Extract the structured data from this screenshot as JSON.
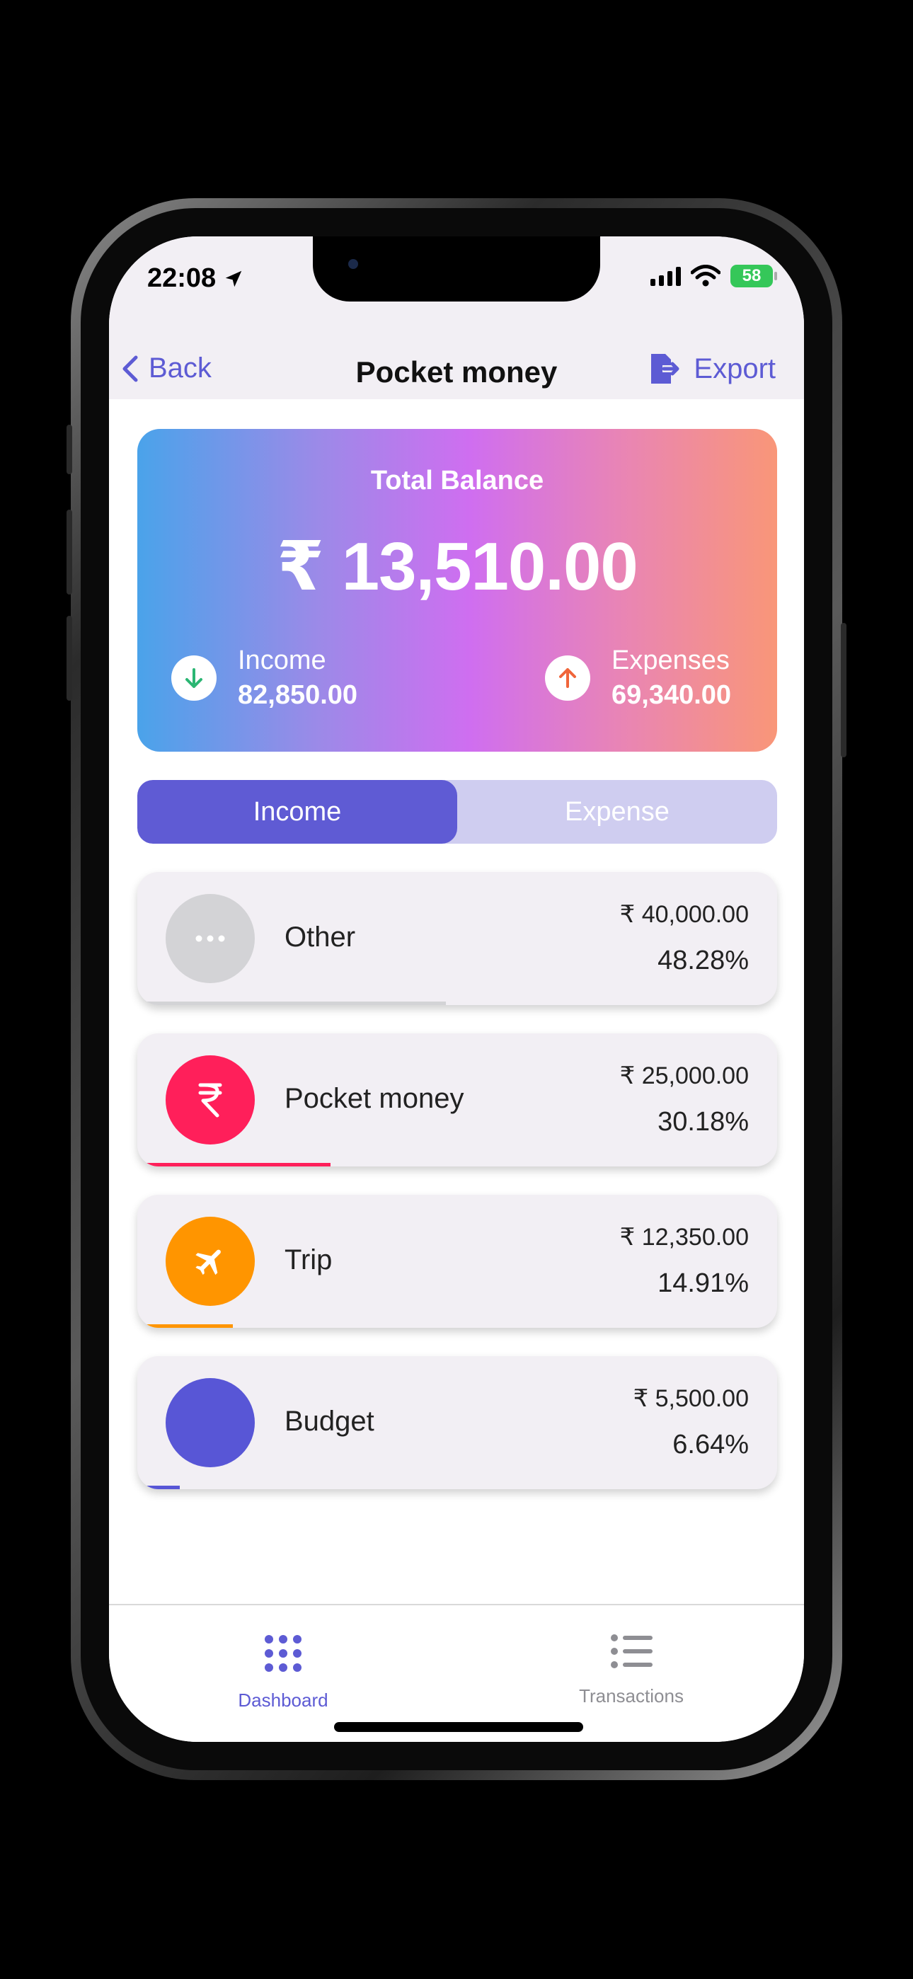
{
  "status": {
    "time": "22:08",
    "battery": "58"
  },
  "nav": {
    "back_label": "Back",
    "title": "Pocket money",
    "export_label": "Export"
  },
  "balance": {
    "label": "Total Balance",
    "amount": "₹ 13,510.00",
    "income_label": "Income",
    "income_value": "82,850.00",
    "expense_label": "Expenses",
    "expense_value": "69,340.00"
  },
  "tabs": {
    "income": "Income",
    "expense": "Expense",
    "active": "Income"
  },
  "categories": [
    {
      "name": "Other",
      "amount": "₹ 40,000.00",
      "percent": "48.28%",
      "share": 0.4828,
      "color": "#d3d3d6",
      "icon": "more-dots-icon"
    },
    {
      "name": "Pocket money",
      "amount": "₹ 25,000.00",
      "percent": "30.18%",
      "share": 0.3018,
      "color": "#ff1f5a",
      "icon": "rupee-icon"
    },
    {
      "name": "Trip",
      "amount": "₹ 12,350.00",
      "percent": "14.91%",
      "share": 0.1491,
      "color": "#ff9500",
      "icon": "airplane-icon"
    },
    {
      "name": "Budget",
      "amount": "₹ 5,500.00",
      "percent": "6.64%",
      "share": 0.0664,
      "color": "#5856d6",
      "icon": "circle-icon"
    }
  ],
  "bottom_tabs": {
    "dashboard": "Dashboard",
    "transactions": "Transactions"
  },
  "colors": {
    "accent": "#5d5bd4",
    "income_arrow": "#2bb673",
    "expense_arrow": "#f0653a",
    "inactive_tab": "#8e8e93"
  }
}
